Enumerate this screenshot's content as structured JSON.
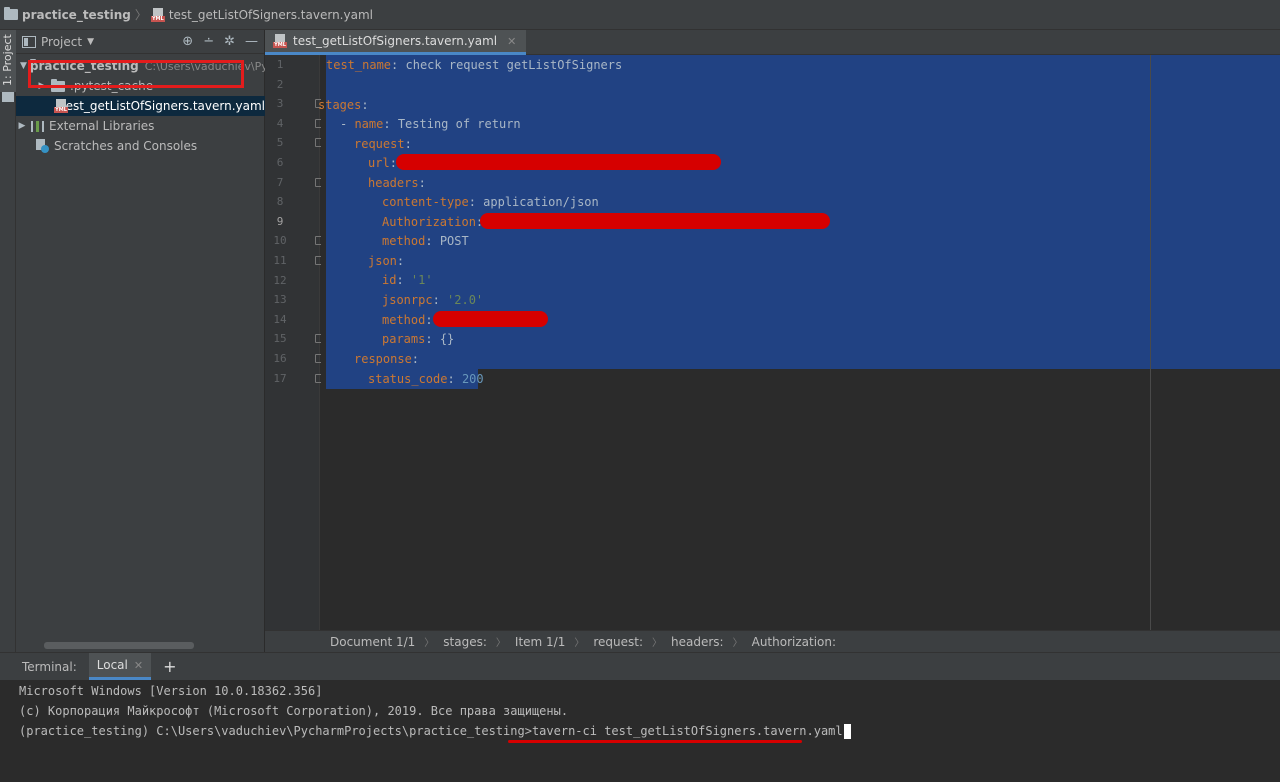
{
  "navbar": {
    "project": "practice_testing",
    "file": "test_getListOfSigners.tavern.yaml"
  },
  "left_strip": {
    "tab_label": "1: Project"
  },
  "project_panel": {
    "title": "Project",
    "tree": {
      "root_label": "practice_testing",
      "root_path": "C:\\Users\\vaduchiev\\Py",
      "cache_folder": ".pytest_cache",
      "selected_file": "test_getListOfSigners.tavern.yaml",
      "external_libraries": "External Libraries",
      "scratches": "Scratches and Consoles"
    }
  },
  "editor": {
    "tab_label": "test_getListOfSigners.tavern.yaml",
    "line_numbers": [
      "1",
      "2",
      "3",
      "4",
      "5",
      "6",
      "7",
      "8",
      "9",
      "10",
      "11",
      "12",
      "13",
      "14",
      "15",
      "16",
      "17"
    ],
    "current_line": 9,
    "code": {
      "l1_key": "test_name",
      "l1_val": " check request getListOfSigners",
      "l3_key": "stages",
      "l4_dash": "- ",
      "l4_key": "name",
      "l4_val": " Testing of return",
      "l5_key": "request",
      "l6_key": "url",
      "l7_key": "headers",
      "l8_key": "content-type",
      "l8_val": " application/json",
      "l9_key": "Authorization",
      "l10_key": "method",
      "l10_val": " POST",
      "l11_key": "json",
      "l12_key": "id",
      "l12_val": "'1'",
      "l13_key": "jsonrpc",
      "l13_val": "'2.0'",
      "l14_key": "method",
      "l15_key": "params",
      "l15_val": " {}",
      "l16_key": "response",
      "l17_key": "status_code",
      "l17_val": "200"
    }
  },
  "breadcrumbs": [
    "Document 1/1",
    "stages:",
    "Item 1/1",
    "request:",
    "headers:",
    "Authorization:"
  ],
  "terminal": {
    "label": "Terminal:",
    "tab": "Local",
    "line1": "Microsoft Windows [Version 10.0.18362.356]",
    "line2": "(c) Корпорация Майкрософт (Microsoft Corporation), 2019. Все права защищены.",
    "prompt": "(practice_testing) C:\\Users\\vaduchiev\\PycharmProjects\\practice_testing>",
    "command": "tavern-ci test_getListOfSigners.tavern.yaml"
  },
  "colors": {
    "selection": "#214283",
    "keyword": "#cc7832",
    "string": "#6a8759",
    "number": "#6897bb",
    "redaction": "#d60000",
    "highlight_border": "#e31c1c"
  }
}
